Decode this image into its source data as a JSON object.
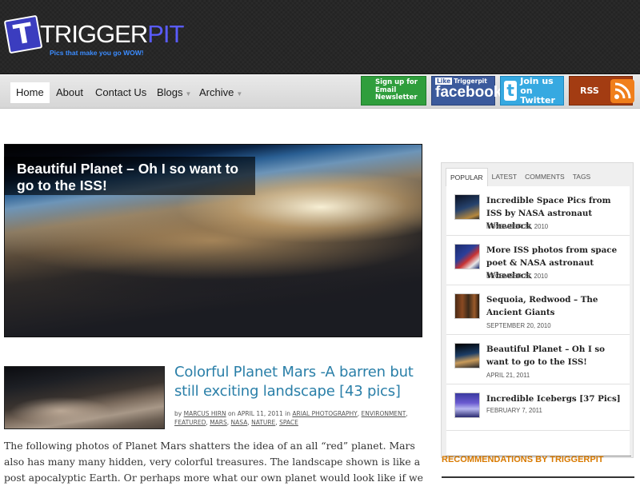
{
  "site": {
    "logo_letter": "T",
    "logo_white": "TRIGGER",
    "logo_blue": "PIT",
    "tagline": "Pics that make you go WOW!",
    "accent": "#2a7fa8",
    "orange": "#d97a00"
  },
  "nav": {
    "items": [
      {
        "label": "Home",
        "active": true
      },
      {
        "label": "About"
      },
      {
        "label": "Contact Us"
      },
      {
        "label": "Blogs",
        "dropdown": true
      },
      {
        "label": "Archive",
        "dropdown": true
      }
    ]
  },
  "social": {
    "email_label": "Sign up for Email Newsletter",
    "email_lines": [
      "Sign up for",
      "Email",
      "Newsletter"
    ],
    "fb_like": "Like",
    "fb_page": "Triggerpit",
    "fb_name": "facebook",
    "twitter_lines": [
      "Join us",
      "on Twitter"
    ],
    "rss": "RSS"
  },
  "hero": {
    "caption": "Beautiful Planet – Oh I so want to go to the ISS!"
  },
  "article": {
    "title": "Colorful Planet Mars -A barren but still exciting landscape [43 pics]",
    "by": "by",
    "author": "MARCUS HIRN",
    "on": "on",
    "date": "APRIL 11, 2011",
    "in": "in",
    "categories": [
      "ARIAL PHOTOGRAPHY",
      "ENVIRONMENT",
      "FEATURED",
      "MARS",
      "NASA",
      "NATURE",
      "SPACE"
    ],
    "excerpt": "The following photos of Planet Mars shatters the idea of an all “red” planet. Mars also has many many hidden, very colorful treasures. The landscape shown is like a post apocalyptic Earth. Or perhaps more what our own planet would look like if we removed almost all life. Nonetheless the Mars landscape is breathtaking and fu"
  },
  "sidebar": {
    "tabs": [
      "POPULAR",
      "LATEST",
      "COMMENTS",
      "TAGS"
    ],
    "active_tab": "POPULAR",
    "posts": [
      {
        "title": "Incredible Space Pics from ISS by NASA astronaut Wheelock",
        "date": "NOVEMBER 22, 2010"
      },
      {
        "title": "More ISS photos from space poet & NASA astronaut Wheelock",
        "date": "DECEMBER 23, 2010"
      },
      {
        "title": "Sequoia, Redwood – The Ancient Giants",
        "date": "SEPTEMBER 20, 2010"
      },
      {
        "title": "Beautiful Planet – Oh I so want to go to the ISS!",
        "date": "APRIL 21, 2011"
      },
      {
        "title": "Incredible Icebergs [37 Pics]",
        "date": "FEBRUARY 7, 2011"
      }
    ],
    "recommendations_title": "RECOMMENDATIONS BY TRIGGERPIT"
  }
}
